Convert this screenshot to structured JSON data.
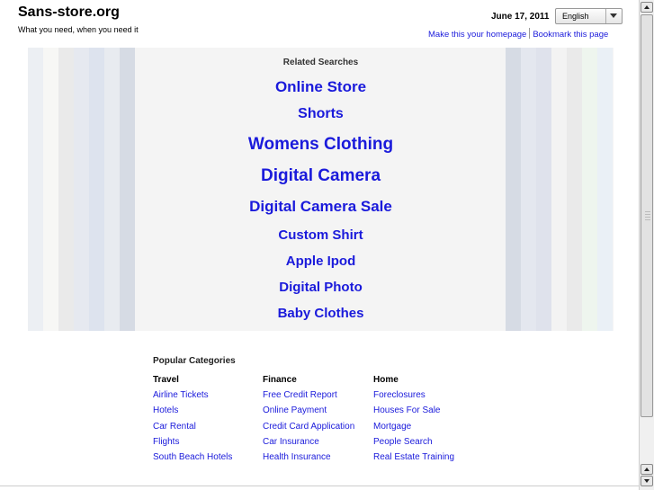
{
  "header": {
    "site_title": "Sans-store.org",
    "tagline": "What you need, when you need it",
    "date": "June 17, 2011",
    "language": "English",
    "homepage_link": "Make this your homepage",
    "bookmark_link": "Bookmark this page"
  },
  "related": {
    "heading": "Related Searches",
    "links": [
      "Online Store",
      "Shorts",
      "Womens Clothing",
      "Digital Camera",
      "Digital Camera Sale",
      "Custom Shirt",
      "Apple Ipod",
      "Digital Photo",
      "Baby Clothes"
    ]
  },
  "popular": {
    "heading": "Popular Categories",
    "columns": [
      {
        "title": "Travel",
        "links": [
          "Airline Tickets",
          "Hotels",
          "Car Rental",
          "Flights",
          "South Beach Hotels"
        ]
      },
      {
        "title": "Finance",
        "links": [
          "Free Credit Report",
          "Online Payment",
          "Credit Card Application",
          "Car Insurance",
          "Health Insurance"
        ]
      },
      {
        "title": "Home",
        "links": [
          "Foreclosures",
          "Houses For Sale",
          "Mortgage",
          "People Search",
          "Real Estate Training"
        ]
      }
    ]
  },
  "colors": {
    "link": "#1a1adb",
    "band_background": "#f4f4f4",
    "stripes_left": [
      "#eceff3",
      "#f7f7f5",
      "#eaeaea",
      "#e6e9f0",
      "#dde3ee",
      "#e8ebf0",
      "#d6dbe4"
    ],
    "stripes_right": [
      "#d6dbe4",
      "#e4e7ef",
      "#dfe2ec",
      "#f3f3f3",
      "#eaeaea",
      "#eef5ee",
      "#eaf0f6"
    ]
  },
  "scrollbar": {
    "up_icon": "arrow-up-icon",
    "down_icon": "arrow-down-icon"
  }
}
